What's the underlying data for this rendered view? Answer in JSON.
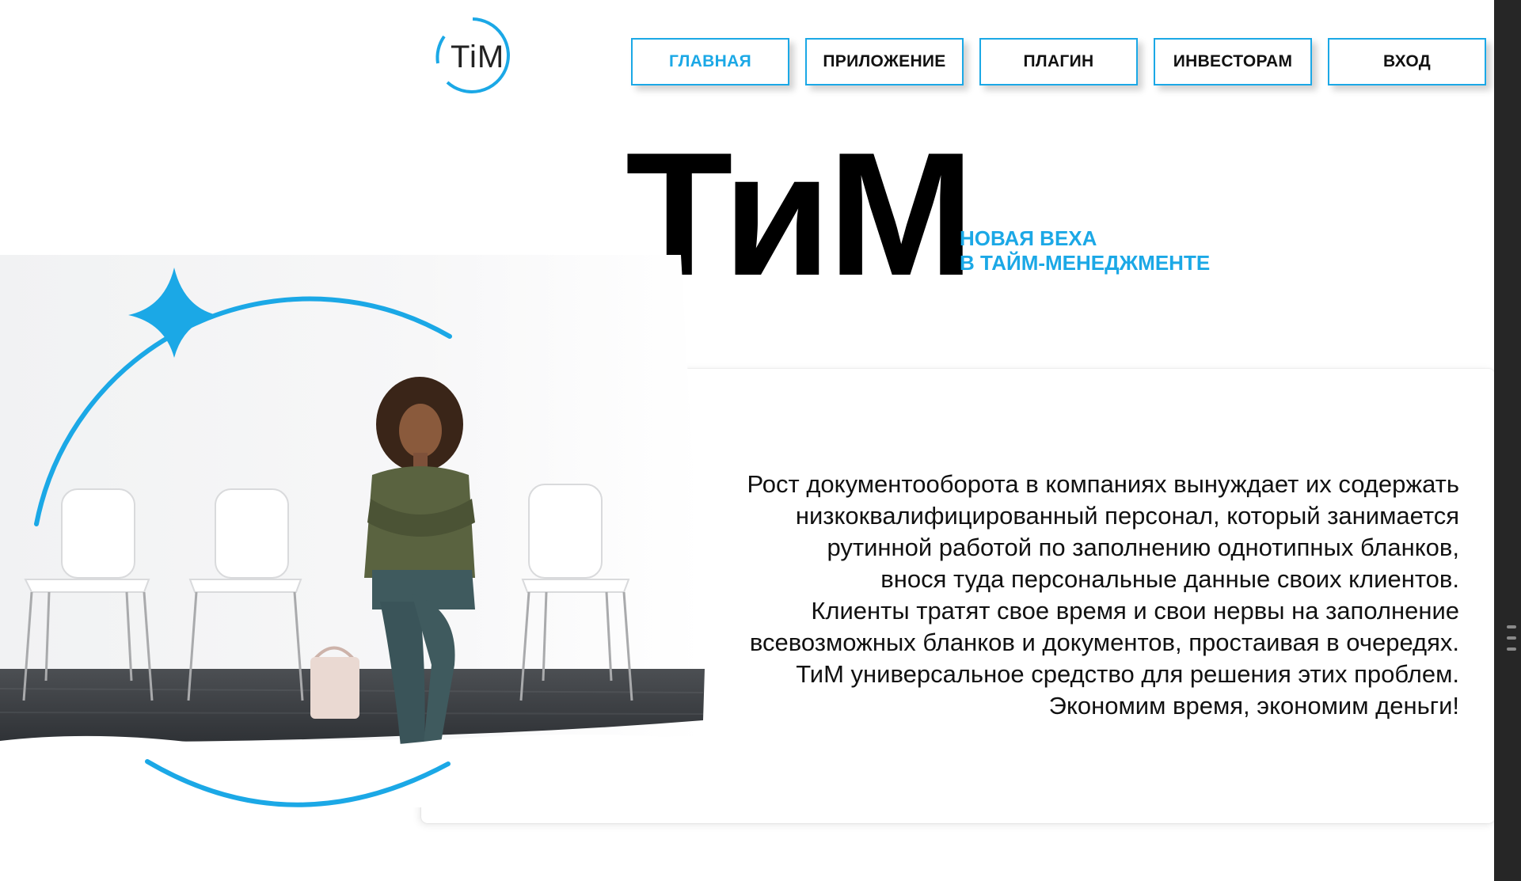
{
  "logo": {
    "text": "TiM"
  },
  "nav": [
    {
      "label": "ГЛАВНАЯ",
      "active": true
    },
    {
      "label": "ПРИЛОЖЕНИЕ",
      "active": false
    },
    {
      "label": "ПЛАГИН",
      "active": false
    },
    {
      "label": "ИНВЕСТОРАМ",
      "active": false
    },
    {
      "label": "ВХОД",
      "active": false
    }
  ],
  "hero": {
    "title": "ТиМ",
    "subtitle_line1": "НОВАЯ ВЕХА",
    "subtitle_line2": "В ТАЙМ-МЕНЕДЖМЕНТЕ"
  },
  "card": {
    "lines": [
      "Рост документооборота в компаниях вынуждает их содержать",
      "низкоквалифицированный персонал, который занимается",
      "рутинной работой по заполнению однотипных бланков,",
      "внося туда персональные данные своих клиентов.",
      "Клиенты тратят свое время и свои нервы на заполнение",
      "всевозможных бланков и документов, простаивая в очередях.",
      "ТиМ универсальное средство для решения этих проблем.",
      "Экономим время, экономим деньги!"
    ]
  },
  "colors": {
    "accent": "#1ba8e6",
    "text": "#111111"
  },
  "icons": {
    "logo_ring": "logo-ring-icon",
    "star": "sparkle-star-icon"
  }
}
